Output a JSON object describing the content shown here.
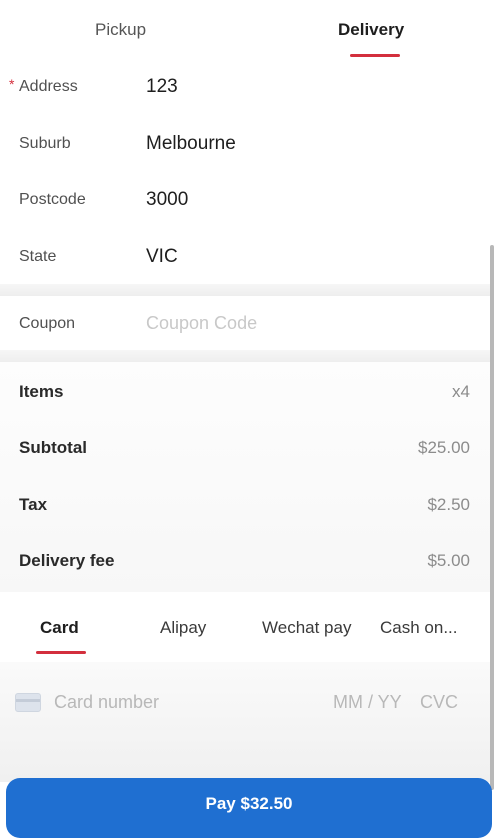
{
  "tabs": {
    "pickup": "Pickup",
    "delivery": "Delivery"
  },
  "address_form": {
    "required_marker": "*",
    "address": {
      "label": "Address",
      "value": "123"
    },
    "suburb": {
      "label": "Suburb",
      "value": "Melbourne"
    },
    "postcode": {
      "label": "Postcode",
      "value": "3000"
    },
    "state": {
      "label": "State",
      "value": "VIC"
    }
  },
  "coupon": {
    "label": "Coupon",
    "placeholder": "Coupon Code"
  },
  "summary": {
    "items": {
      "label": "Items",
      "value": "x4"
    },
    "subtotal": {
      "label": "Subtotal",
      "value": "$25.00"
    },
    "tax": {
      "label": "Tax",
      "value": "$2.50"
    },
    "delivery_fee": {
      "label": "Delivery fee",
      "value": "$5.00"
    }
  },
  "payment_tabs": [
    "Card",
    "Alipay",
    "Wechat pay",
    "Cash on..."
  ],
  "card": {
    "icon": "credit-card-icon",
    "number_placeholder": "Card number",
    "expiry_placeholder": "MM / YY",
    "cvc_placeholder": "CVC"
  },
  "pay_button": {
    "label": "Pay $32.50"
  },
  "colors": {
    "accent": "#d32f3d",
    "button": "#1f6fd1"
  }
}
